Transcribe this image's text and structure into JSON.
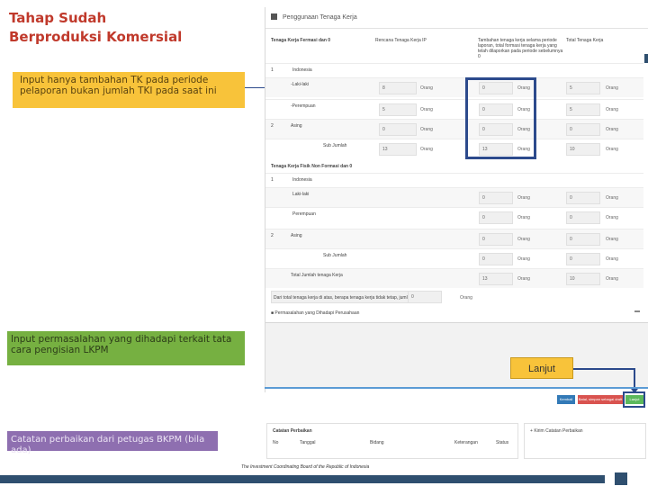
{
  "slide": {
    "title_line1": "Tahap Sudah",
    "title_line2": "Berproduksi Komersial",
    "callout_tk": "Input hanya tambahan TK pada periode pelaporan bukan jumlah TKI pada saat ini",
    "callout_permasalahan": "Input permasalahan yang dihadapi terkait tata cara pengisian LKPM",
    "callout_catatan": "Catatan perbaikan dari petugas BKPM (bila ada)",
    "lanjut_label": "Lanjut",
    "footer": "The Investment Coordinating Board of the Republic of Indonesia"
  },
  "screen": {
    "header": "Penggunaan Tenaga Kerja",
    "col_labels": {
      "a": "Tenaga Kerja Fermasi dan 0",
      "b": "Rencana Tenaga Kerja IP",
      "c": "Tambahan tenaga kerja selama periode laporan, total formasi tenaga kerja yang telah dilaporkan pada periode sebelumnya 0",
      "d": "Total Tenaga Kerja"
    },
    "section2": "Tenaga Kerja Fisik Non Formasi dan 0",
    "rows": {
      "r1_no": "1",
      "r1_label": "Indonesia",
      "r_laki": "-Laki-laki",
      "r_perempuan": "-Perempuan",
      "r2_no": "2",
      "r2_label": "Asing",
      "r_sub": "Sub Jumlah",
      "r3_no": "1",
      "r3_label": "Indonesia",
      "r3_laki": "Laki-laki",
      "r3_perempuan": "Perempuan",
      "r4_no": "2",
      "r4_label": "Asing",
      "r4_sub": "Sub Jumlah",
      "r_total": "Total Jumlah tenaga Kerja"
    },
    "values": {
      "laki": [
        "8",
        "0",
        "5"
      ],
      "perempuan": [
        "5",
        "0",
        "5"
      ],
      "asing": [
        "0",
        "0",
        "0"
      ],
      "sub": [
        "13",
        "13",
        "10"
      ],
      "fisik_laki": [
        "0",
        "0"
      ],
      "fisik_perempuan": [
        "0",
        "0"
      ],
      "fisik_asing": [
        "0",
        "0"
      ],
      "fisik_sub": [
        "0",
        "0"
      ],
      "total": [
        "13",
        "10"
      ]
    },
    "unit": "Orang",
    "summary_label": "Dari total tenaga kerja di atas, berapa tenaga kerja tidak tetap, jumlahnya",
    "summary_value": "0",
    "perm_heading": "Permasalahan yang Dihadapi Perusahaan",
    "buttons": {
      "kembali": "Kembali",
      "batal": "Batal, simpan sebagai draft",
      "lanjut": "Lanjut"
    },
    "catatan_heading": "Catatan Perbaikan",
    "catatan_cols": [
      "No",
      "Tanggal",
      "Bidang",
      "Keterangan",
      "Status"
    ],
    "kirim_heading": "Kirim Catatan Perbaikan"
  }
}
